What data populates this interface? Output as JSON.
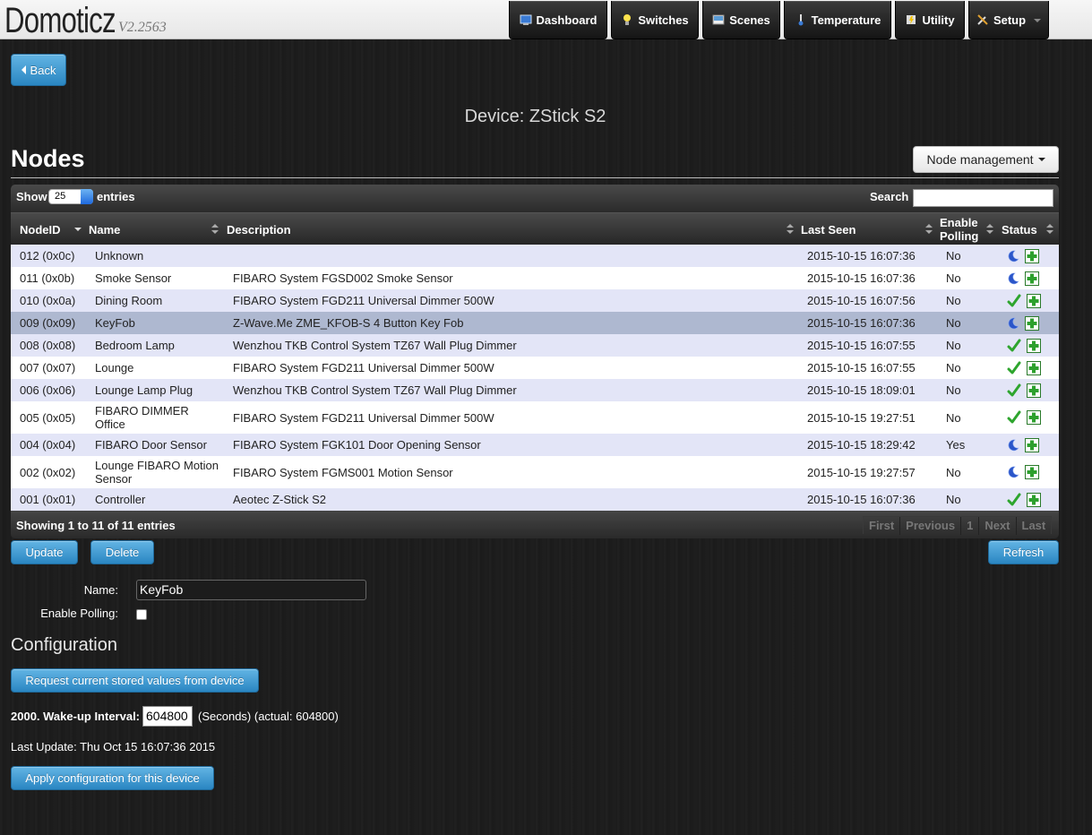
{
  "header": {
    "brand": "Domoticz",
    "version": "V2.2563",
    "nav": [
      {
        "label": "Dashboard",
        "icon": "dashboard-icon"
      },
      {
        "label": "Switches",
        "icon": "lightbulb-icon"
      },
      {
        "label": "Scenes",
        "icon": "scenes-icon"
      },
      {
        "label": "Temperature",
        "icon": "thermometer-icon"
      },
      {
        "label": "Utility",
        "icon": "utility-icon"
      },
      {
        "label": "Setup",
        "icon": "tools-icon"
      }
    ]
  },
  "back_label": "Back",
  "device_title": "Device: ZStick S2",
  "nodes_heading": "Nodes",
  "node_management_label": "Node management",
  "table": {
    "show_label": "Show",
    "page_length": "25",
    "entries_label": "entries",
    "search_label": "Search :",
    "search_value": "",
    "columns": [
      "NodeID",
      "Name",
      "Description",
      "Last Seen",
      "Enable Polling",
      "Status"
    ],
    "rows": [
      {
        "id": "012 (0x0c)",
        "name": "Unknown",
        "desc": "",
        "seen": "2015-10-15 16:07:36",
        "polling": "No",
        "status": "sleeping"
      },
      {
        "id": "011 (0x0b)",
        "name": "Smoke Sensor",
        "desc": "FIBARO System FGSD002 Smoke Sensor",
        "seen": "2015-10-15 16:07:36",
        "polling": "No",
        "status": "sleeping"
      },
      {
        "id": "010 (0x0a)",
        "name": "Dining Room",
        "desc": "FIBARO System FGD211 Universal Dimmer 500W",
        "seen": "2015-10-15 16:07:56",
        "polling": "No",
        "status": "ok"
      },
      {
        "id": "009 (0x09)",
        "name": "KeyFob",
        "desc": "Z-Wave.Me ZME_KFOB-S 4 Button Key Fob",
        "seen": "2015-10-15 16:07:36",
        "polling": "No",
        "status": "sleeping"
      },
      {
        "id": "008 (0x08)",
        "name": "Bedroom Lamp",
        "desc": "Wenzhou TKB Control System TZ67 Wall Plug Dimmer",
        "seen": "2015-10-15 16:07:55",
        "polling": "No",
        "status": "ok"
      },
      {
        "id": "007 (0x07)",
        "name": "Lounge",
        "desc": "FIBARO System FGD211 Universal Dimmer 500W",
        "seen": "2015-10-15 16:07:55",
        "polling": "No",
        "status": "ok"
      },
      {
        "id": "006 (0x06)",
        "name": "Lounge Lamp Plug",
        "desc": "Wenzhou TKB Control System TZ67 Wall Plug Dimmer",
        "seen": "2015-10-15 18:09:01",
        "polling": "No",
        "status": "ok"
      },
      {
        "id": "005 (0x05)",
        "name": "FIBARO DIMMER Office",
        "desc": "FIBARO System FGD211 Universal Dimmer 500W",
        "seen": "2015-10-15 19:27:51",
        "polling": "No",
        "status": "ok"
      },
      {
        "id": "004 (0x04)",
        "name": "FIBARO Door Sensor",
        "desc": "FIBARO System FGK101 Door Opening Sensor",
        "seen": "2015-10-15 18:29:42",
        "polling": "Yes",
        "status": "sleeping"
      },
      {
        "id": "002 (0x02)",
        "name": "Lounge FIBARO Motion Sensor",
        "desc": "FIBARO System FGMS001 Motion Sensor",
        "seen": "2015-10-15 19:27:57",
        "polling": "No",
        "status": "sleeping"
      },
      {
        "id": "001 (0x01)",
        "name": "Controller",
        "desc": "Aeotec Z-Stick S2",
        "seen": "2015-10-15 16:07:36",
        "polling": "No",
        "status": "ok"
      }
    ],
    "selected_row_index": 3,
    "info": "Showing 1 to 11 of 11 entries",
    "pager": [
      "First",
      "Previous",
      "1",
      "Next",
      "Last"
    ]
  },
  "buttons": {
    "update": "Update",
    "delete": "Delete",
    "refresh": "Refresh"
  },
  "form": {
    "name_label": "Name:",
    "name_value": "KeyFob",
    "polling_label": "Enable Polling:",
    "polling_checked": false
  },
  "configuration": {
    "heading": "Configuration",
    "request_button": "Request current stored values from device",
    "wakeup_label": "2000. Wake-up Interval:",
    "wakeup_value": "604800",
    "wakeup_suffix": "(Seconds) (actual: 604800)",
    "last_update": "Last Update: Thu Oct 15 16:07:36 2015",
    "apply_button": "Apply configuration for this device"
  },
  "colors": {
    "accent_blue": "#2a86c2",
    "row_odd": "#e3e5f7",
    "row_selected": "#aeb8d0",
    "status_ok": "#2ea52e",
    "status_sleep": "#2a55c9",
    "add_icon": "#2da02d"
  }
}
